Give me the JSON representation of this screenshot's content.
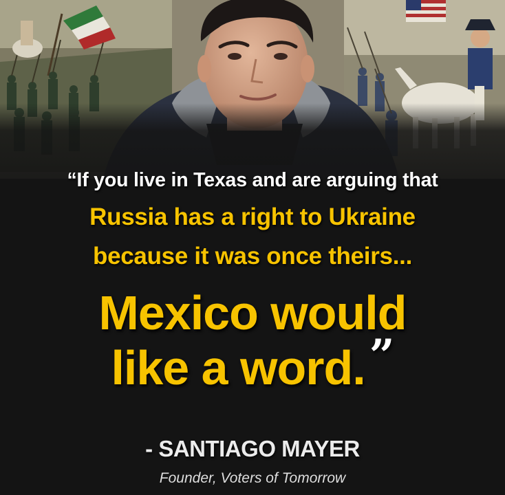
{
  "quote": {
    "line1": "“If you live in Texas and are arguing that",
    "line2": "Russia has a right to Ukraine",
    "line3": "because it was once theirs...",
    "line4": "Mexico would",
    "line5": "like a word.",
    "close_mark": "”"
  },
  "attribution": {
    "name": "- SANTIAGO MAYER",
    "role": "Founder, Voters of Tomorrow"
  },
  "colors": {
    "highlight": "#f7c300",
    "text": "#ffffff",
    "background": "#141414"
  }
}
